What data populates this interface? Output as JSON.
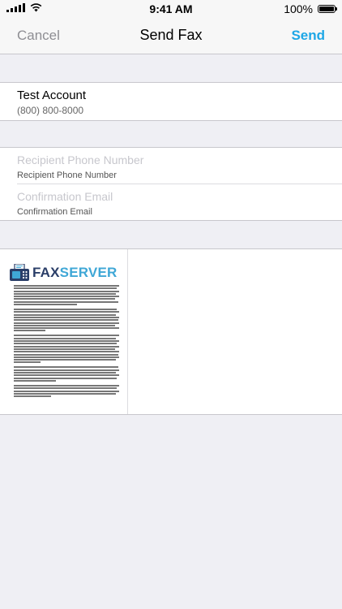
{
  "status_bar": {
    "time": "9:41 AM",
    "battery_percent": "100%"
  },
  "nav": {
    "cancel_label": "Cancel",
    "title": "Send Fax",
    "send_label": "Send"
  },
  "account": {
    "name": "Test Account",
    "phone": "(800) 800-8000"
  },
  "fields": {
    "recipient": {
      "placeholder": "Recipient Phone Number",
      "label": "Recipient Phone Number"
    },
    "email": {
      "placeholder": "Confirmation Email",
      "label": "Confirmation Email"
    }
  },
  "preview": {
    "logo_fax": "FAX",
    "logo_server": "SERVER"
  },
  "colors": {
    "accent": "#1ea7e6",
    "background": "#efeff4",
    "logo_dark": "#2a3e68",
    "logo_light": "#3fa7d6"
  }
}
